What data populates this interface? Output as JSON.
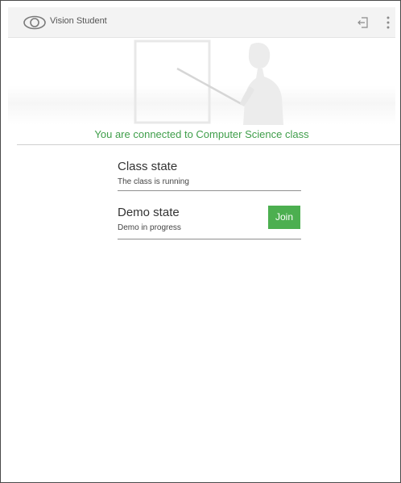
{
  "appbar": {
    "title": "Vision Student",
    "logo_icon": "eye-icon",
    "exit_icon": "exit-icon",
    "menu_icon": "more-vert-icon"
  },
  "banner": {
    "illustration": "teacher-at-whiteboard"
  },
  "status": {
    "text": "You are connected to Computer Science class",
    "color": "#3f9e4a"
  },
  "states": [
    {
      "title": "Class state",
      "subtitle": "The class is running"
    },
    {
      "title": "Demo state",
      "subtitle": "Demo in progress",
      "action_label": "Join"
    }
  ],
  "colors": {
    "accent": "#4caf50",
    "appbar_bg": "#f3f3f3"
  }
}
